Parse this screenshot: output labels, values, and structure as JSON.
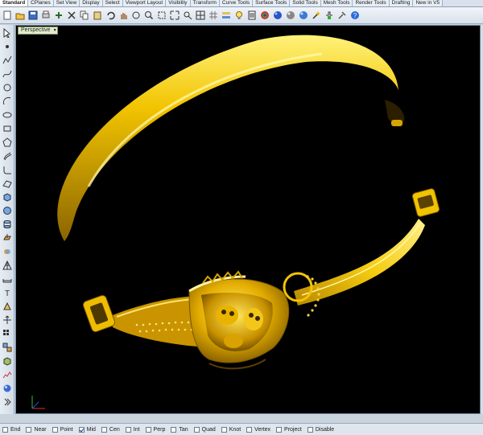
{
  "tabs": [
    {
      "label": "Standard",
      "active": true
    },
    {
      "label": "CPlanes"
    },
    {
      "label": "Set View"
    },
    {
      "label": "Display"
    },
    {
      "label": "Select"
    },
    {
      "label": "Viewport Layout"
    },
    {
      "label": "Visibility"
    },
    {
      "label": "Transform"
    },
    {
      "label": "Curve Tools"
    },
    {
      "label": "Surface Tools"
    },
    {
      "label": "Solid Tools"
    },
    {
      "label": "Mesh Tools"
    },
    {
      "label": "Render Tools"
    },
    {
      "label": "Drafting"
    },
    {
      "label": "New in V5"
    }
  ],
  "toolbar_icons": [
    "new-file-icon",
    "open-file-icon",
    "save-file-icon",
    "print-icon",
    "import-icon",
    "cut-icon",
    "copy-icon",
    "paste-icon",
    "undo-icon",
    "pan-hand-icon",
    "rotate-view-icon",
    "zoom-icon",
    "zoom-window-icon",
    "zoom-extents-icon",
    "zoom-selected-icon",
    "four-viewports-icon",
    "grid-icon",
    "layer-icon",
    "lightbulb-icon",
    "properties-icon",
    "material-sphere-icon",
    "render-icon",
    "rendered-sphere-icon",
    "shaded-sphere-icon",
    "wand-icon",
    "snap-icon",
    "tools-icon",
    "help-icon"
  ],
  "left_tool_icons": [
    "select-arrow-icon",
    "point-icon",
    "polyline-icon",
    "curve-icon",
    "circle-icon",
    "arc-icon",
    "ellipse-icon",
    "rectangle-icon",
    "polygon-icon",
    "offset-icon",
    "fillet-icon",
    "surface-icon",
    "box-icon",
    "sphere-icon",
    "cylinder-icon",
    "extrude-icon",
    "boolean-icon",
    "mesh-icon",
    "dimension-icon",
    "text-icon",
    "transform-icon",
    "move-icon",
    "array-icon",
    "group-icon",
    "block-icon",
    "analyze-icon",
    "render-icon",
    "expand-icon"
  ],
  "viewport": {
    "name": "Perspective"
  },
  "osnaps": [
    {
      "label": "End",
      "checked": false
    },
    {
      "label": "Near",
      "checked": false
    },
    {
      "label": "Point",
      "checked": false
    },
    {
      "label": "Mid",
      "checked": true
    },
    {
      "label": "Cen",
      "checked": false
    },
    {
      "label": "Int",
      "checked": false
    },
    {
      "label": "Perp",
      "checked": false
    },
    {
      "label": "Tan",
      "checked": false
    },
    {
      "label": "Quad",
      "checked": false
    },
    {
      "label": "Knot",
      "checked": false
    },
    {
      "label": "Vertex",
      "checked": false
    },
    {
      "label": "Project",
      "checked": false
    },
    {
      "label": "Disable",
      "checked": false
    }
  ],
  "colors": {
    "gold_light": "#fff27a",
    "gold": "#f2c400",
    "gold_dark": "#8a6400",
    "viewport_bg": "#000000"
  }
}
